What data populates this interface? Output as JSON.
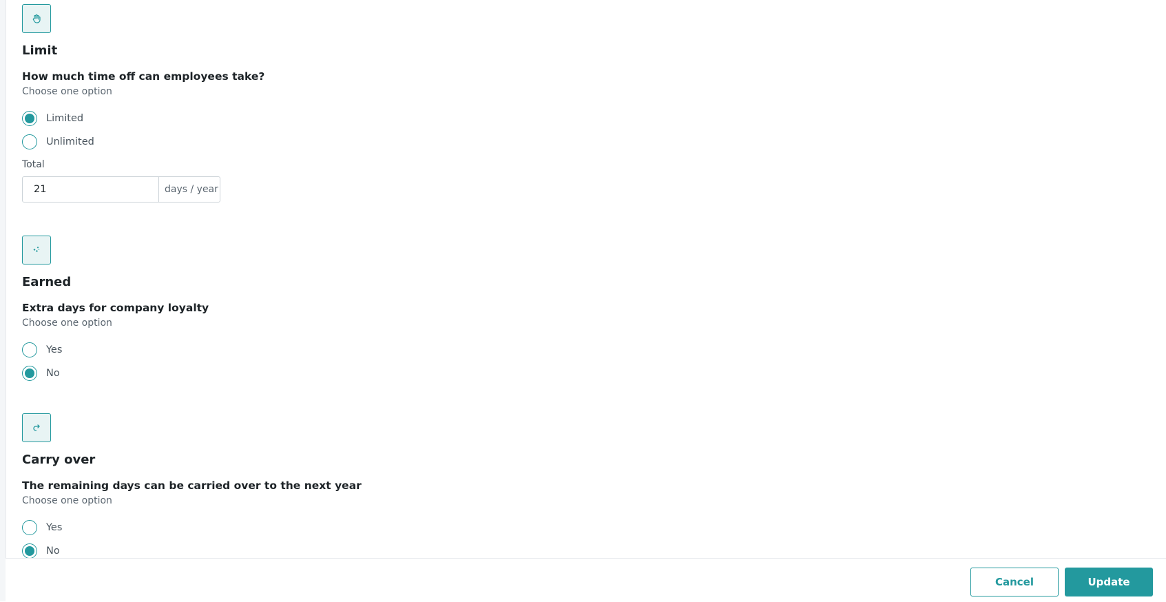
{
  "sections": [
    {
      "icon": "hand-icon",
      "title": "Limit",
      "question": "How much time off can employees take?",
      "hint": "Choose one option",
      "options": [
        {
          "label": "Limited",
          "checked": true
        },
        {
          "label": "Unlimited",
          "checked": false
        }
      ],
      "total": {
        "label": "Total",
        "value": "21",
        "unit": "days / year"
      }
    },
    {
      "icon": "sparkles-icon",
      "title": "Earned",
      "question": "Extra days for company loyalty",
      "hint": "Choose one option",
      "options": [
        {
          "label": "Yes",
          "checked": false
        },
        {
          "label": "No",
          "checked": true
        }
      ]
    },
    {
      "icon": "redo-arrow-icon",
      "title": "Carry over",
      "question": "The remaining days can be carried over to the next year",
      "hint": "Choose one option",
      "options": [
        {
          "label": "Yes",
          "checked": false
        },
        {
          "label": "No",
          "checked": true
        }
      ]
    }
  ],
  "footer": {
    "cancel_label": "Cancel",
    "update_label": "Update"
  },
  "colors": {
    "accent": "#23999e",
    "icon_bg": "#e8f4f4"
  }
}
